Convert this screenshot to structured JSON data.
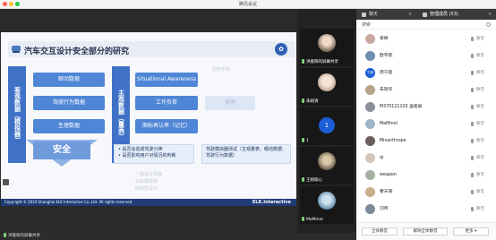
{
  "window": {
    "title": "腾讯会议"
  },
  "slide": {
    "title": "汽车交互设计安全部分的研究",
    "left_block": "客观数据（模拟器）",
    "mid_block": "主观数据（量表）",
    "boxes_left": [
      "眼动数据",
      "驾驶行为数据",
      "生理数据"
    ],
    "boxes_mid": [
      "Situational Awareness",
      "工作负荷",
      "图标再认率（记忆）"
    ],
    "boxes_faded": [
      "其他"
    ],
    "faded_right_top": "研究手段",
    "safety": "安全",
    "bullets_mid": [
      "是否会造成驾驶分神",
      "是否影响用户对情况的判断"
    ],
    "bullets_right": "驾驶模拟器测试（主观量表、眼动数据、驾驶行为数据）",
    "faded_lines": [
      "一般设计层面",
      "对车载系统",
      "的研究设计"
    ],
    "footer_copyright": "Copyright © 2019 Shanghai ELK Interactive Co.,Ltd. All rights reserved.",
    "footer_brand": "ELK.Interactive"
  },
  "video_tiles": [
    {
      "label": "洪嘉辉的屏幕共享",
      "kind": "photo"
    },
    {
      "label": "朱婉清",
      "kind": "photo"
    },
    {
      "label": "1",
      "kind": "blue",
      "avatar_text": "1"
    },
    {
      "label": "王婉瑜心",
      "kind": "photo"
    },
    {
      "label": "MaMinol",
      "kind": "photo"
    }
  ],
  "bottom_bar": {
    "label": "洪嘉辉的屏幕共享"
  },
  "panel": {
    "tab_chat": "聊天",
    "tab_members": "管理成员 (53)",
    "close": "×",
    "search_label": "搜索",
    "members": [
      {
        "name": "章婷",
        "status": "静音"
      },
      {
        "name": "欧宇航",
        "status": "静音"
      },
      {
        "name": "周宁超",
        "status": "静音",
        "avatar_text": "宁超"
      },
      {
        "name": "朱则华",
        "status": "静音"
      },
      {
        "name": "M370121103 吴栢辰",
        "status": "静音"
      },
      {
        "name": "MaMinol",
        "status": "静音"
      },
      {
        "name": "Misanthrope",
        "status": "静音"
      },
      {
        "name": "qi",
        "status": "静音"
      },
      {
        "name": "weapon",
        "status": "静音"
      },
      {
        "name": "曹天琦",
        "status": "静音"
      },
      {
        "name": "刘伟",
        "status": "静音"
      }
    ],
    "btn_mute_all": "全体静音",
    "btn_unmute_all": "解除全体静音",
    "btn_more": "更多 ▾"
  },
  "colors": {
    "accent": "#1b5dd6",
    "slide_blue": "#4f86d6"
  }
}
